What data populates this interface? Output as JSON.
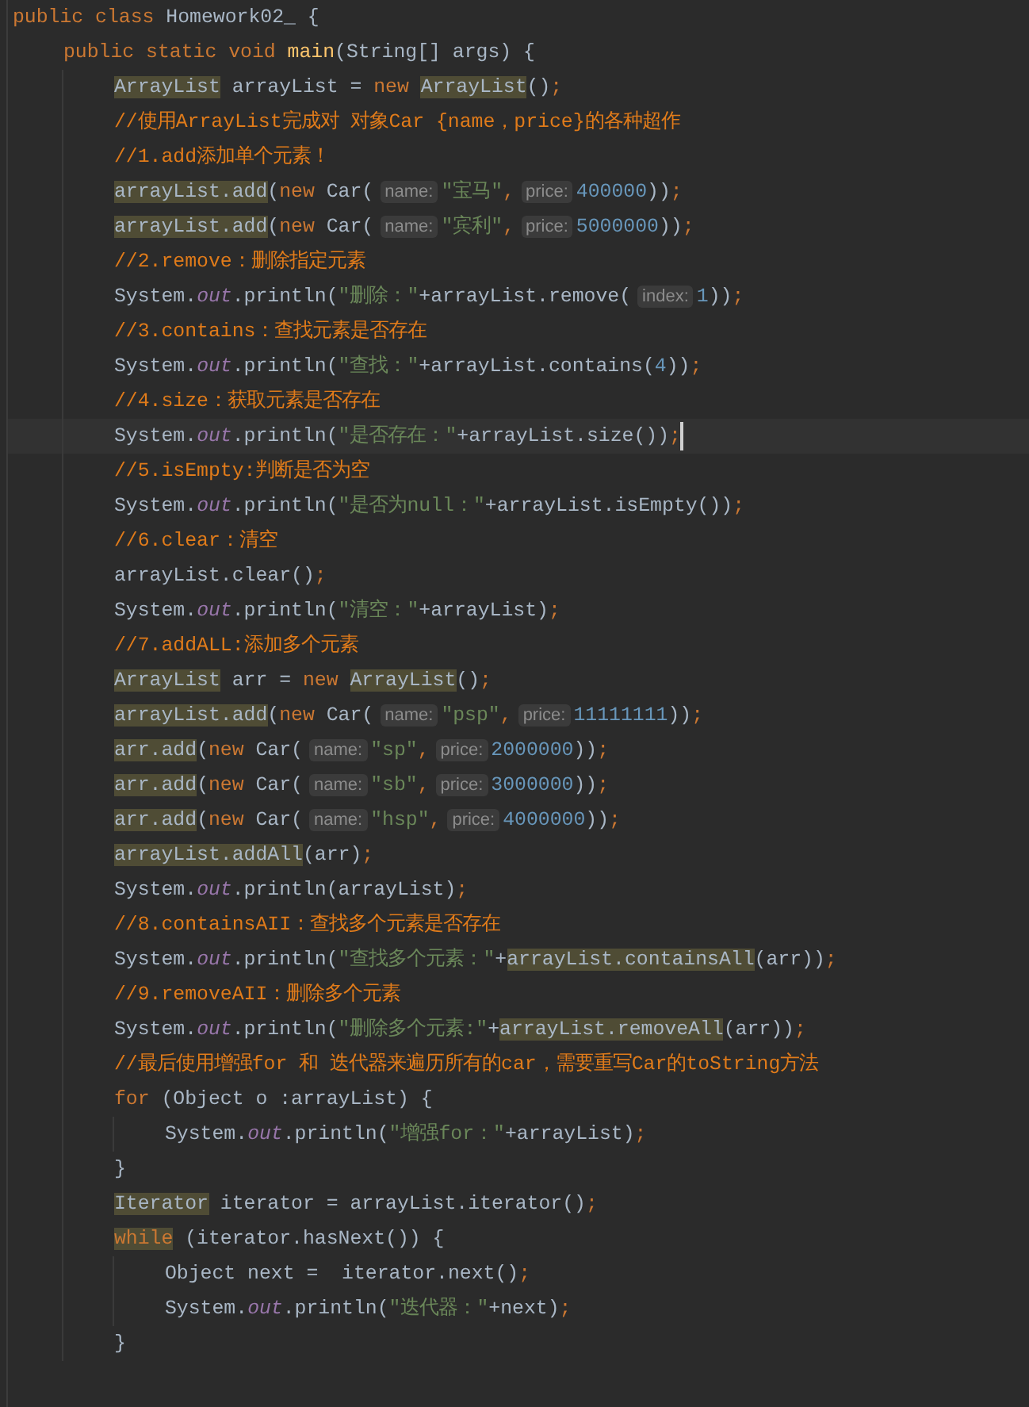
{
  "editor": {
    "lines": [
      {
        "current": false,
        "tokens": [
          {
            "kind": "keyword",
            "text": "public class",
            "marked": false
          },
          {
            "kind": "plain",
            "text": " Homework02_ {",
            "marked": false
          }
        ],
        "children": [
          {
            "current": false,
            "tokens": [
              {
                "kind": "keyword",
                "text": "public static void ",
                "marked": false
              },
              {
                "kind": "method",
                "text": "main",
                "marked": false
              },
              {
                "kind": "plain",
                "text": "(String[] args) {",
                "marked": false
              }
            ],
            "children": [
              {
                "current": false,
                "tokens": [
                  {
                    "kind": "plain",
                    "text": "ArrayList",
                    "marked": true
                  },
                  {
                    "kind": "plain",
                    "text": " arrayList = ",
                    "marked": false
                  },
                  {
                    "kind": "keyword",
                    "text": "new ",
                    "marked": false
                  },
                  {
                    "kind": "plain",
                    "text": "ArrayList",
                    "marked": true
                  },
                  {
                    "kind": "plain",
                    "text": "()",
                    "marked": false
                  },
                  {
                    "kind": "keyword",
                    "text": ";",
                    "marked": false
                  }
                ]
              },
              {
                "current": false,
                "tokens": [
                  {
                    "kind": "comment",
                    "text": "//使用ArrayList完成对 对象Car {name，price}的各种超作",
                    "marked": false
                  }
                ]
              },
              {
                "current": false,
                "tokens": [
                  {
                    "kind": "comment",
                    "text": "//1.add添加单个元素！",
                    "marked": false
                  }
                ]
              },
              {
                "current": false,
                "tokens": [
                  {
                    "kind": "plain",
                    "text": "arrayList.add",
                    "marked": true
                  },
                  {
                    "kind": "plain",
                    "text": "(",
                    "marked": false
                  },
                  {
                    "kind": "keyword",
                    "text": "new ",
                    "marked": false
                  },
                  {
                    "kind": "plain",
                    "text": "Car(",
                    "marked": false
                  },
                  {
                    "kind": "hint",
                    "text": "name:",
                    "marked": false
                  },
                  {
                    "kind": "string",
                    "text": "\"宝马\"",
                    "marked": false
                  },
                  {
                    "kind": "keyword",
                    "text": ",",
                    "marked": false
                  },
                  {
                    "kind": "hint",
                    "text": "price:",
                    "marked": false
                  },
                  {
                    "kind": "number",
                    "text": "400000",
                    "marked": false
                  },
                  {
                    "kind": "plain",
                    "text": "))",
                    "marked": false
                  },
                  {
                    "kind": "keyword",
                    "text": ";",
                    "marked": false
                  }
                ]
              },
              {
                "current": false,
                "tokens": [
                  {
                    "kind": "plain",
                    "text": "arrayList.add",
                    "marked": true
                  },
                  {
                    "kind": "plain",
                    "text": "(",
                    "marked": false
                  },
                  {
                    "kind": "keyword",
                    "text": "new ",
                    "marked": false
                  },
                  {
                    "kind": "plain",
                    "text": "Car(",
                    "marked": false
                  },
                  {
                    "kind": "hint",
                    "text": "name:",
                    "marked": false
                  },
                  {
                    "kind": "string",
                    "text": "\"宾利\"",
                    "marked": false
                  },
                  {
                    "kind": "keyword",
                    "text": ",",
                    "marked": false
                  },
                  {
                    "kind": "hint",
                    "text": "price:",
                    "marked": false
                  },
                  {
                    "kind": "number",
                    "text": "5000000",
                    "marked": false
                  },
                  {
                    "kind": "plain",
                    "text": "))",
                    "marked": false
                  },
                  {
                    "kind": "keyword",
                    "text": ";",
                    "marked": false
                  }
                ]
              },
              {
                "current": false,
                "tokens": [
                  {
                    "kind": "comment",
                    "text": "//2.remove：删除指定元素",
                    "marked": false
                  }
                ]
              },
              {
                "current": false,
                "tokens": [
                  {
                    "kind": "plain",
                    "text": "System.",
                    "marked": false
                  },
                  {
                    "kind": "static",
                    "text": "out",
                    "marked": false
                  },
                  {
                    "kind": "plain",
                    "text": ".println(",
                    "marked": false
                  },
                  {
                    "kind": "string",
                    "text": "\"删除：\"",
                    "marked": false
                  },
                  {
                    "kind": "plain",
                    "text": "+arrayList.remove(",
                    "marked": false
                  },
                  {
                    "kind": "hint",
                    "text": "index:",
                    "marked": false
                  },
                  {
                    "kind": "number",
                    "text": "1",
                    "marked": false
                  },
                  {
                    "kind": "plain",
                    "text": "))",
                    "marked": false
                  },
                  {
                    "kind": "keyword",
                    "text": ";",
                    "marked": false
                  }
                ]
              },
              {
                "current": false,
                "tokens": [
                  {
                    "kind": "comment",
                    "text": "//3.contains：查找元素是否存在",
                    "marked": false
                  }
                ]
              },
              {
                "current": false,
                "tokens": [
                  {
                    "kind": "plain",
                    "text": "System.",
                    "marked": false
                  },
                  {
                    "kind": "static",
                    "text": "out",
                    "marked": false
                  },
                  {
                    "kind": "plain",
                    "text": ".println(",
                    "marked": false
                  },
                  {
                    "kind": "string",
                    "text": "\"查找：\"",
                    "marked": false
                  },
                  {
                    "kind": "plain",
                    "text": "+arrayList.contains(",
                    "marked": false
                  },
                  {
                    "kind": "number",
                    "text": "4",
                    "marked": false
                  },
                  {
                    "kind": "plain",
                    "text": "))",
                    "marked": false
                  },
                  {
                    "kind": "keyword",
                    "text": ";",
                    "marked": false
                  }
                ]
              },
              {
                "current": false,
                "tokens": [
                  {
                    "kind": "comment",
                    "text": "//4.size：获取元素是否存在",
                    "marked": false
                  }
                ]
              },
              {
                "current": true,
                "tokens": [
                  {
                    "kind": "plain",
                    "text": "System.",
                    "marked": false
                  },
                  {
                    "kind": "static",
                    "text": "out",
                    "marked": false
                  },
                  {
                    "kind": "plain",
                    "text": ".println(",
                    "marked": false
                  },
                  {
                    "kind": "string",
                    "text": "\"是否存在：\"",
                    "marked": false
                  },
                  {
                    "kind": "plain",
                    "text": "+arrayList.size())",
                    "marked": false
                  },
                  {
                    "kind": "keyword",
                    "text": ";",
                    "marked": false
                  }
                ]
              },
              {
                "current": false,
                "tokens": [
                  {
                    "kind": "comment",
                    "text": "//5.isEmpty:判断是否为空",
                    "marked": false
                  }
                ]
              },
              {
                "current": false,
                "tokens": [
                  {
                    "kind": "plain",
                    "text": "System.",
                    "marked": false
                  },
                  {
                    "kind": "static",
                    "text": "out",
                    "marked": false
                  },
                  {
                    "kind": "plain",
                    "text": ".println(",
                    "marked": false
                  },
                  {
                    "kind": "string",
                    "text": "\"是否为null：\"",
                    "marked": false
                  },
                  {
                    "kind": "plain",
                    "text": "+arrayList.isEmpty())",
                    "marked": false
                  },
                  {
                    "kind": "keyword",
                    "text": ";",
                    "marked": false
                  }
                ]
              },
              {
                "current": false,
                "tokens": [
                  {
                    "kind": "comment",
                    "text": "//6.clear：清空",
                    "marked": false
                  }
                ]
              },
              {
                "current": false,
                "tokens": [
                  {
                    "kind": "plain",
                    "text": "arrayList.clear()",
                    "marked": false
                  },
                  {
                    "kind": "keyword",
                    "text": ";",
                    "marked": false
                  }
                ]
              },
              {
                "current": false,
                "tokens": [
                  {
                    "kind": "plain",
                    "text": "System.",
                    "marked": false
                  },
                  {
                    "kind": "static",
                    "text": "out",
                    "marked": false
                  },
                  {
                    "kind": "plain",
                    "text": ".println(",
                    "marked": false
                  },
                  {
                    "kind": "string",
                    "text": "\"清空：\"",
                    "marked": false
                  },
                  {
                    "kind": "plain",
                    "text": "+arrayList)",
                    "marked": false
                  },
                  {
                    "kind": "keyword",
                    "text": ";",
                    "marked": false
                  }
                ]
              },
              {
                "current": false,
                "tokens": [
                  {
                    "kind": "comment",
                    "text": "//7.addALL:添加多个元素",
                    "marked": false
                  }
                ]
              },
              {
                "current": false,
                "tokens": [
                  {
                    "kind": "plain",
                    "text": "ArrayList",
                    "marked": true
                  },
                  {
                    "kind": "plain",
                    "text": " arr = ",
                    "marked": false
                  },
                  {
                    "kind": "keyword",
                    "text": "new ",
                    "marked": false
                  },
                  {
                    "kind": "plain",
                    "text": "ArrayList",
                    "marked": true
                  },
                  {
                    "kind": "plain",
                    "text": "()",
                    "marked": false
                  },
                  {
                    "kind": "keyword",
                    "text": ";",
                    "marked": false
                  }
                ]
              },
              {
                "current": false,
                "tokens": [
                  {
                    "kind": "plain",
                    "text": "arrayList.add",
                    "marked": true
                  },
                  {
                    "kind": "plain",
                    "text": "(",
                    "marked": false
                  },
                  {
                    "kind": "keyword",
                    "text": "new ",
                    "marked": false
                  },
                  {
                    "kind": "plain",
                    "text": "Car(",
                    "marked": false
                  },
                  {
                    "kind": "hint",
                    "text": "name:",
                    "marked": false
                  },
                  {
                    "kind": "string",
                    "text": "\"psp\"",
                    "marked": false
                  },
                  {
                    "kind": "keyword",
                    "text": ",",
                    "marked": false
                  },
                  {
                    "kind": "hint",
                    "text": "price:",
                    "marked": false
                  },
                  {
                    "kind": "number",
                    "text": "11111111",
                    "marked": false
                  },
                  {
                    "kind": "plain",
                    "text": "))",
                    "marked": false
                  },
                  {
                    "kind": "keyword",
                    "text": ";",
                    "marked": false
                  }
                ]
              },
              {
                "current": false,
                "tokens": [
                  {
                    "kind": "plain",
                    "text": "arr.add",
                    "marked": true
                  },
                  {
                    "kind": "plain",
                    "text": "(",
                    "marked": false
                  },
                  {
                    "kind": "keyword",
                    "text": "new ",
                    "marked": false
                  },
                  {
                    "kind": "plain",
                    "text": "Car(",
                    "marked": false
                  },
                  {
                    "kind": "hint",
                    "text": "name:",
                    "marked": false
                  },
                  {
                    "kind": "string",
                    "text": "\"sp\"",
                    "marked": false
                  },
                  {
                    "kind": "keyword",
                    "text": ",",
                    "marked": false
                  },
                  {
                    "kind": "hint",
                    "text": "price:",
                    "marked": false
                  },
                  {
                    "kind": "number",
                    "text": "2000000",
                    "marked": false
                  },
                  {
                    "kind": "plain",
                    "text": "))",
                    "marked": false
                  },
                  {
                    "kind": "keyword",
                    "text": ";",
                    "marked": false
                  }
                ]
              },
              {
                "current": false,
                "tokens": [
                  {
                    "kind": "plain",
                    "text": "arr.add",
                    "marked": true
                  },
                  {
                    "kind": "plain",
                    "text": "(",
                    "marked": false
                  },
                  {
                    "kind": "keyword",
                    "text": "new ",
                    "marked": false
                  },
                  {
                    "kind": "plain",
                    "text": "Car(",
                    "marked": false
                  },
                  {
                    "kind": "hint",
                    "text": "name:",
                    "marked": false
                  },
                  {
                    "kind": "string",
                    "text": "\"sb\"",
                    "marked": false
                  },
                  {
                    "kind": "keyword",
                    "text": ",",
                    "marked": false
                  },
                  {
                    "kind": "hint",
                    "text": "price:",
                    "marked": false
                  },
                  {
                    "kind": "number",
                    "text": "3000000",
                    "marked": false
                  },
                  {
                    "kind": "plain",
                    "text": "))",
                    "marked": false
                  },
                  {
                    "kind": "keyword",
                    "text": ";",
                    "marked": false
                  }
                ]
              },
              {
                "current": false,
                "tokens": [
                  {
                    "kind": "plain",
                    "text": "arr.add",
                    "marked": true
                  },
                  {
                    "kind": "plain",
                    "text": "(",
                    "marked": false
                  },
                  {
                    "kind": "keyword",
                    "text": "new ",
                    "marked": false
                  },
                  {
                    "kind": "plain",
                    "text": "Car(",
                    "marked": false
                  },
                  {
                    "kind": "hint",
                    "text": "name:",
                    "marked": false
                  },
                  {
                    "kind": "string",
                    "text": "\"hsp\"",
                    "marked": false
                  },
                  {
                    "kind": "keyword",
                    "text": ",",
                    "marked": false
                  },
                  {
                    "kind": "hint",
                    "text": "price:",
                    "marked": false
                  },
                  {
                    "kind": "number",
                    "text": "4000000",
                    "marked": false
                  },
                  {
                    "kind": "plain",
                    "text": "))",
                    "marked": false
                  },
                  {
                    "kind": "keyword",
                    "text": ";",
                    "marked": false
                  }
                ]
              },
              {
                "current": false,
                "tokens": [
                  {
                    "kind": "plain",
                    "text": "arrayList.addAll",
                    "marked": true
                  },
                  {
                    "kind": "plain",
                    "text": "(arr)",
                    "marked": false
                  },
                  {
                    "kind": "keyword",
                    "text": ";",
                    "marked": false
                  }
                ]
              },
              {
                "current": false,
                "tokens": [
                  {
                    "kind": "plain",
                    "text": "System.",
                    "marked": false
                  },
                  {
                    "kind": "static",
                    "text": "out",
                    "marked": false
                  },
                  {
                    "kind": "plain",
                    "text": ".println(arrayList)",
                    "marked": false
                  },
                  {
                    "kind": "keyword",
                    "text": ";",
                    "marked": false
                  }
                ]
              },
              {
                "current": false,
                "tokens": [
                  {
                    "kind": "comment",
                    "text": "//8.containsAII：查找多个元素是否存在",
                    "marked": false
                  }
                ]
              },
              {
                "current": false,
                "tokens": [
                  {
                    "kind": "plain",
                    "text": "System.",
                    "marked": false
                  },
                  {
                    "kind": "static",
                    "text": "out",
                    "marked": false
                  },
                  {
                    "kind": "plain",
                    "text": ".println(",
                    "marked": false
                  },
                  {
                    "kind": "string",
                    "text": "\"查找多个元素：\"",
                    "marked": false
                  },
                  {
                    "kind": "plain",
                    "text": "+",
                    "marked": false
                  },
                  {
                    "kind": "plain",
                    "text": "arrayList.containsAll",
                    "marked": true
                  },
                  {
                    "kind": "plain",
                    "text": "(arr))",
                    "marked": false
                  },
                  {
                    "kind": "keyword",
                    "text": ";",
                    "marked": false
                  }
                ]
              },
              {
                "current": false,
                "tokens": [
                  {
                    "kind": "comment",
                    "text": "//9.removeAII：删除多个元素",
                    "marked": false
                  }
                ]
              },
              {
                "current": false,
                "tokens": [
                  {
                    "kind": "plain",
                    "text": "System.",
                    "marked": false
                  },
                  {
                    "kind": "static",
                    "text": "out",
                    "marked": false
                  },
                  {
                    "kind": "plain",
                    "text": ".println(",
                    "marked": false
                  },
                  {
                    "kind": "string",
                    "text": "\"删除多个元素:\"",
                    "marked": false
                  },
                  {
                    "kind": "plain",
                    "text": "+",
                    "marked": false
                  },
                  {
                    "kind": "plain",
                    "text": "arrayList.removeAll",
                    "marked": true
                  },
                  {
                    "kind": "plain",
                    "text": "(arr))",
                    "marked": false
                  },
                  {
                    "kind": "keyword",
                    "text": ";",
                    "marked": false
                  }
                ]
              },
              {
                "current": false,
                "tokens": [
                  {
                    "kind": "comment",
                    "text": "//最后使用增强for 和 迭代器来遍历所有的car，需要重写Car的toString方法",
                    "marked": false
                  }
                ]
              },
              {
                "current": false,
                "tokens": [
                  {
                    "kind": "keyword",
                    "text": "for ",
                    "marked": false
                  },
                  {
                    "kind": "plain",
                    "text": "(Object o :arrayList) {",
                    "marked": false
                  }
                ],
                "children": [
                  {
                    "current": false,
                    "tokens": [
                      {
                        "kind": "plain",
                        "text": "System.",
                        "marked": false
                      },
                      {
                        "kind": "static",
                        "text": "out",
                        "marked": false
                      },
                      {
                        "kind": "plain",
                        "text": ".println(",
                        "marked": false
                      },
                      {
                        "kind": "string",
                        "text": "\"增强for：\"",
                        "marked": false
                      },
                      {
                        "kind": "plain",
                        "text": "+arrayList)",
                        "marked": false
                      },
                      {
                        "kind": "keyword",
                        "text": ";",
                        "marked": false
                      }
                    ]
                  }
                ]
              },
              {
                "current": false,
                "tokens": [
                  {
                    "kind": "plain",
                    "text": "}",
                    "marked": false
                  }
                ]
              },
              {
                "current": false,
                "tokens": [
                  {
                    "kind": "plain",
                    "text": "Iterator",
                    "marked": true
                  },
                  {
                    "kind": "plain",
                    "text": " iterator = arrayList.iterator()",
                    "marked": false
                  },
                  {
                    "kind": "keyword",
                    "text": ";",
                    "marked": false
                  }
                ]
              },
              {
                "current": false,
                "tokens": [
                  {
                    "kind": "keyword",
                    "text": "while",
                    "marked": true
                  },
                  {
                    "kind": "plain",
                    "text": " (iterator.hasNext()) {",
                    "marked": false
                  }
                ],
                "children": [
                  {
                    "current": false,
                    "tokens": [
                      {
                        "kind": "plain",
                        "text": "Object next =  iterator.next()",
                        "marked": false
                      },
                      {
                        "kind": "keyword",
                        "text": ";",
                        "marked": false
                      }
                    ]
                  },
                  {
                    "current": false,
                    "tokens": [
                      {
                        "kind": "plain",
                        "text": "System.",
                        "marked": false
                      },
                      {
                        "kind": "static",
                        "text": "out",
                        "marked": false
                      },
                      {
                        "kind": "plain",
                        "text": ".println(",
                        "marked": false
                      },
                      {
                        "kind": "string",
                        "text": "\"迭代器：\"",
                        "marked": false
                      },
                      {
                        "kind": "plain",
                        "text": "+next)",
                        "marked": false
                      },
                      {
                        "kind": "keyword",
                        "text": ";",
                        "marked": false
                      }
                    ]
                  }
                ]
              },
              {
                "current": false,
                "tokens": [
                  {
                    "kind": "plain",
                    "text": "}",
                    "marked": false
                  }
                ]
              }
            ]
          }
        ]
      }
    ]
  }
}
